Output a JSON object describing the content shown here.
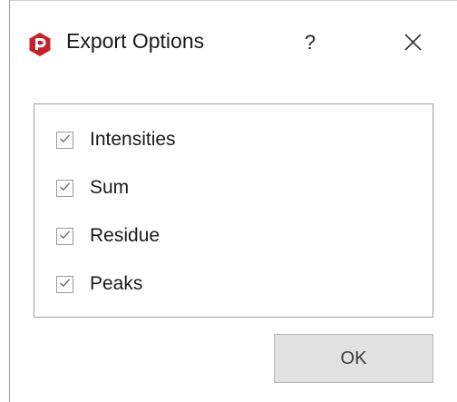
{
  "dialog": {
    "title": "Export Options",
    "help_label": "?",
    "app_icon": "red-hexagon-logo-icon",
    "close_icon": "close-icon"
  },
  "options": [
    {
      "label": "Intensities",
      "checked": true
    },
    {
      "label": "Sum",
      "checked": true
    },
    {
      "label": "Residue",
      "checked": true
    },
    {
      "label": "Peaks",
      "checked": true
    }
  ],
  "buttons": {
    "ok_label": "OK"
  },
  "colors": {
    "brand": "#c8202a",
    "button_bg": "#e1e1e1",
    "checkmark": "#6e6e6e"
  }
}
